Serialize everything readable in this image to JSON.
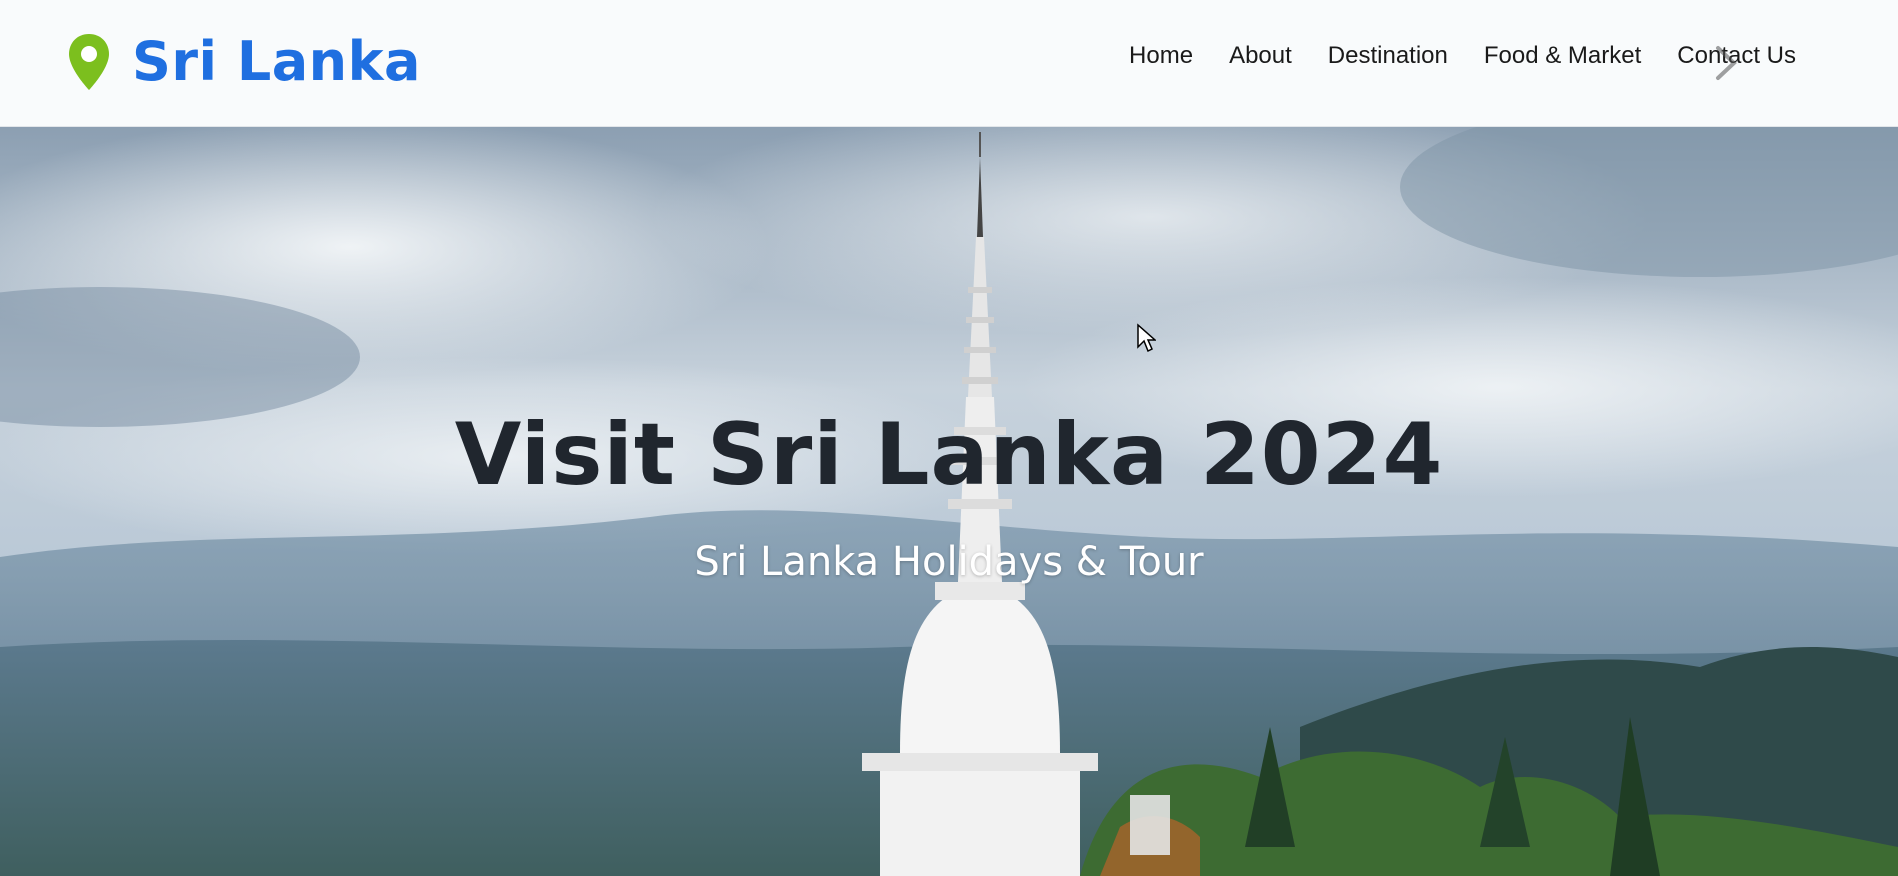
{
  "site": {
    "brand": "Sri Lanka",
    "brand_color": "#1f6fe0",
    "pin_color": "#7cbf1e",
    "pin_icon": "map-pin-icon"
  },
  "nav": {
    "items": [
      {
        "label": "Home"
      },
      {
        "label": "About"
      },
      {
        "label": "Destination"
      },
      {
        "label": "Food & Market"
      },
      {
        "label": "Contact Us"
      }
    ],
    "next_icon": "chevron-right-icon"
  },
  "hero": {
    "title": "Visit Sri Lanka 2024",
    "subtitle": "Sri Lanka Holidays & Tour",
    "title_color": "#20262e",
    "subtitle_color": "#ffffff"
  }
}
